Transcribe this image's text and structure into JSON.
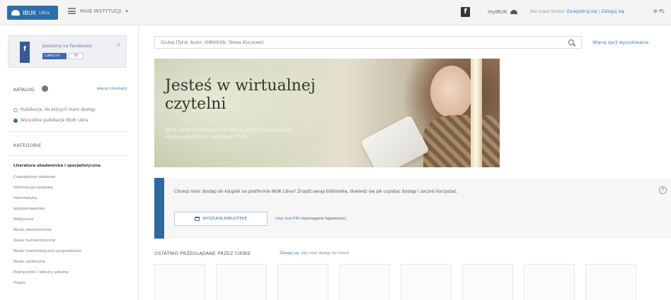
{
  "topbar": {
    "logo_text": "IBUK",
    "logo_sub": "Libra",
    "menu_label": "MAIE INSTYTUCJI",
    "fb_icon_letter": "f",
    "my_ibuk_label": "myIBUK",
    "account_question": "Nie masz konta?",
    "register_link": "Zarejestruj się",
    "separator": "|",
    "login_link": "Zaloguj się",
    "lang_label": "PL"
  },
  "sidebar": {
    "fb_box": {
      "bookmark_letter": "f",
      "title": "Jesteśmy na Facebooku",
      "like_label": "Lubię to!",
      "like_count": "1K",
      "close_label": "×"
    },
    "katalog": {
      "heading": "KATALOG",
      "more_link": "więcej informacji",
      "options": [
        {
          "label": "Publikacje, do których mam dostęp",
          "selected": false
        },
        {
          "label": "Wszystkie publikacje IBUK Libra",
          "selected": true
        }
      ]
    },
    "kategorie": {
      "heading": "KATEGORIE",
      "items": [
        {
          "label": "Literatura akademicka i specjalistyczna",
          "active": true
        },
        {
          "label": "Czasopisma naukowe",
          "active": false
        },
        {
          "label": "Informacja naukowa",
          "active": false
        },
        {
          "label": "Informatyka",
          "active": false
        },
        {
          "label": "Językoznawstwo",
          "active": false
        },
        {
          "label": "Medycyna",
          "active": false
        },
        {
          "label": "Nauki ekonomiczne",
          "active": false
        },
        {
          "label": "Nauki humanistyczne",
          "active": false
        },
        {
          "label": "Nauki matematyczno-przyrodnicze",
          "active": false
        },
        {
          "label": "Nauki społeczne",
          "active": false
        },
        {
          "label": "Podręczniki i lektury szkolne",
          "active": false
        },
        {
          "label": "Prawo",
          "active": false
        }
      ]
    }
  },
  "search": {
    "placeholder": "Szukaj (Tytuł, Autor, ISBN/ISSN, Słowa kluczowe)",
    "advanced_link": "Więcej opcji wyszukiwania"
  },
  "banner": {
    "heading": "Jesteś w wirtualnej czytelni",
    "text": "IBUK Libra to pierwsza w Polsce platforma zasobów edukacyjnych dla instytucji i firm."
  },
  "info": {
    "message": "Chcesz mieć dostęp do książek na platformie IBUK Libra? Znajdź swoją bibliotekę, dowiedz się jak uzyskać dostęp i zacznij korzystać.",
    "find_button": "WYSZUKAJ BIBLIOTEKĘ",
    "pin_link": "Użyj kod PIN",
    "pin_note": "(wymagane logowanie)",
    "help_icon": "?"
  },
  "recent": {
    "heading": "OSTATNIO PRZEGLĄDANE PRZEZ CIEBIE",
    "login_link": "Zaloguj się,",
    "login_note": "aby mieć dostęp do historii"
  },
  "colors": {
    "brand_blue": "#2c6fa8",
    "link_blue": "#3a7cc0",
    "facebook_blue": "#3b5998"
  }
}
